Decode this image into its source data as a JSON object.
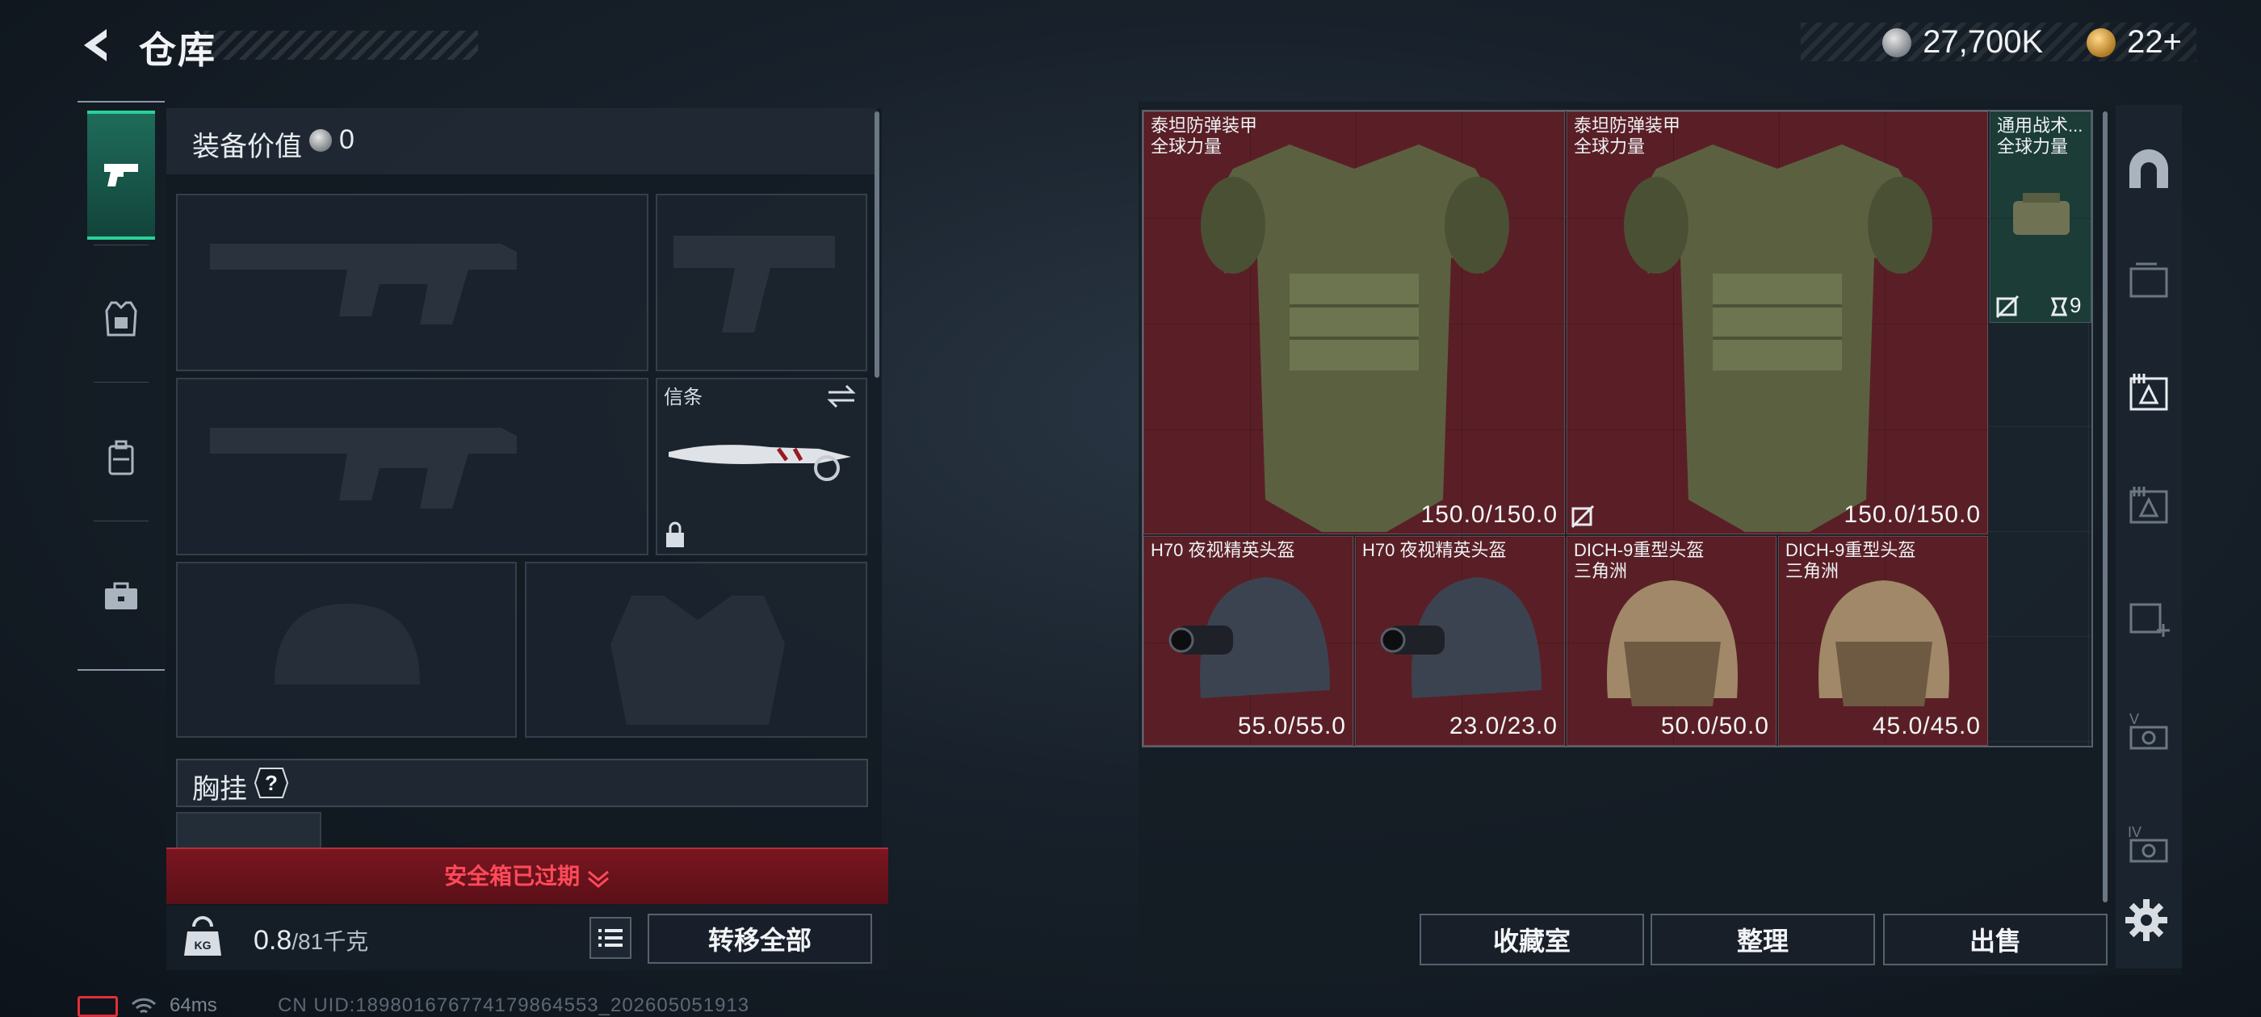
{
  "header": {
    "title": "仓库",
    "currency_silver": "27,700K",
    "currency_gold": "22+"
  },
  "left_tabs": [
    {
      "name": "weapons",
      "icon": "pistol-icon",
      "active": true
    },
    {
      "name": "armor",
      "icon": "vest-icon",
      "active": false
    },
    {
      "name": "backpack",
      "icon": "backpack-icon",
      "active": false
    },
    {
      "name": "toolbox",
      "icon": "briefcase-icon",
      "active": false
    }
  ],
  "equipment": {
    "value_label": "装备价值",
    "value": "0",
    "melee_label": "信条",
    "chest_rig_label": "胸挂",
    "help_glyph": "?",
    "safe_box_text": "安全箱已过期",
    "weight_current": "0.8",
    "weight_capacity": "/81千克",
    "transfer_all": "转移全部"
  },
  "stash_items": [
    {
      "name": "泰坦防弹装甲",
      "sub": "全球力量",
      "durability": "150.0/150.0",
      "color": "#5a1f26"
    },
    {
      "name": "泰坦防弹装甲",
      "sub": "全球力量",
      "durability": "150.0/150.0",
      "color": "#5a1f26"
    },
    {
      "name": "通用战术...",
      "sub": "全球力量",
      "count": "9",
      "color": "#1c3c38"
    },
    {
      "name": "H70 夜视精英头盔",
      "sub": "",
      "durability": "55.0/55.0",
      "color": "#5a1f26"
    },
    {
      "name": "H70 夜视精英头盔",
      "sub": "",
      "durability": "23.0/23.0",
      "color": "#5a1f26"
    },
    {
      "name": "DICH-9重型头盔",
      "sub": "三角洲",
      "durability": "50.0/50.0",
      "color": "#5a1f26"
    },
    {
      "name": "DICH-9重型头盔",
      "sub": "三角洲",
      "durability": "45.0/45.0",
      "color": "#5a1f26"
    }
  ],
  "stash_categories": [
    {
      "icon": "arch-icon"
    },
    {
      "icon": "ammo-crate-icon"
    },
    {
      "icon": "stash-1-icon",
      "active": true
    },
    {
      "icon": "stash-2-icon"
    },
    {
      "icon": "add-stash-icon"
    },
    {
      "icon": "stash-v-icon",
      "label": "V"
    },
    {
      "icon": "stash-iv-icon",
      "label": "IV"
    }
  ],
  "actions": {
    "collection": "收藏室",
    "sort": "整理",
    "sell": "出售"
  },
  "status": {
    "ping": "64ms",
    "uid": "CN UID:1898016767741798645​53_202605051913"
  },
  "colors": {
    "accent_green": "#29d29a",
    "expired_red": "#ff4a5a",
    "item_red": "#5a1f26",
    "item_teal": "#1c3c38"
  }
}
